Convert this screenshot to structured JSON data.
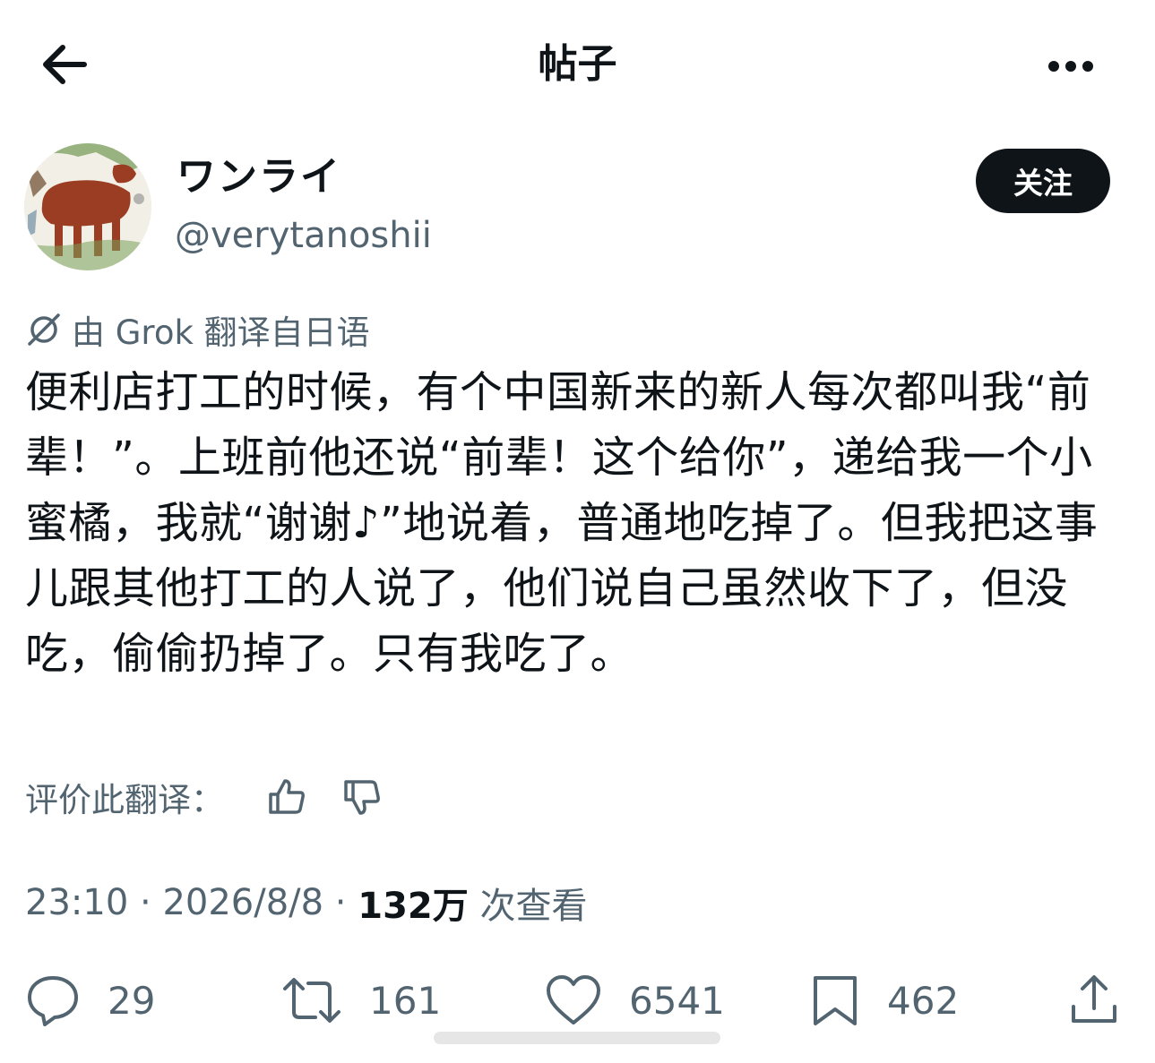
{
  "header": {
    "title": "帖子",
    "back_icon": "arrow-left-icon",
    "more_icon": "more-horizontal-icon"
  },
  "author": {
    "display_name": "ワンライ",
    "handle": "@verytanoshii",
    "follow_label": "关注"
  },
  "translation": {
    "icon": "grok-icon",
    "label": "由 Grok 翻译自日语"
  },
  "post": {
    "text": "便利店打工的时候，有个中国新来的新人每次都叫我“前辈！”。上班前他还说“前辈！这个给你”，递给我一个小蜜橘，我就“谢谢♪”地说着，普通地吃掉了。但我把这事儿跟其他打工的人说了，他们说自己虽然收下了，但没吃，偷偷扔掉了。只有我吃了。"
  },
  "rating": {
    "label": "评价此翻译：",
    "up_icon": "thumbs-up-icon",
    "down_icon": "thumbs-down-icon"
  },
  "meta": {
    "time": "23:10",
    "sep1": " · ",
    "date": "2026/8/8",
    "sep2": " · ",
    "views_count": "132万",
    "views_label": " 次查看"
  },
  "actions": {
    "replies": "29",
    "reposts": "161",
    "likes": "6541",
    "bookmarks": "462"
  },
  "colors": {
    "text": "#0f1419",
    "secondary": "#536471",
    "button_bg": "#0f1419"
  }
}
